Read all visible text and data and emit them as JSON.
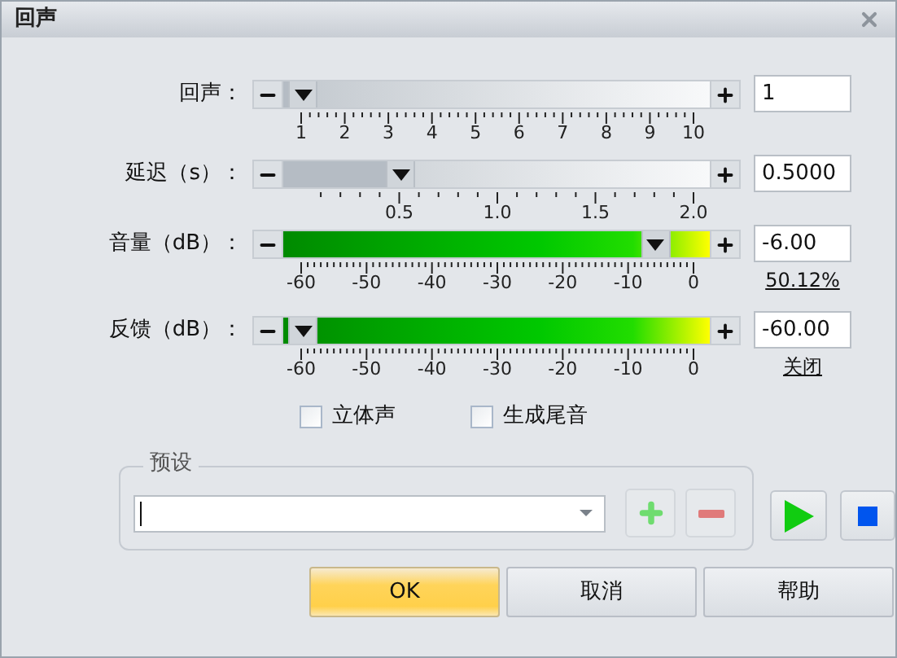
{
  "window": {
    "title": "回声"
  },
  "sliders": [
    {
      "label": "回声：",
      "kind": "plain",
      "level": 0,
      "value": "1",
      "ticks": [
        "1",
        "2",
        "3",
        "4",
        "5",
        "6",
        "7",
        "8",
        "9",
        "10"
      ]
    },
    {
      "label": "延迟（s）：",
      "kind": "plain",
      "level": 0.25,
      "value": "0.5000",
      "ticks": [
        "0.5",
        "1.0",
        "1.5",
        "2.0"
      ],
      "unlabeled_origin": true
    },
    {
      "label": "音量（dB）：",
      "kind": "gain",
      "level": 0.9,
      "value": "-6.00",
      "ticks": [
        "-60",
        "-50",
        "-40",
        "-30",
        "-20",
        "-10",
        "0"
      ],
      "note": "50.12%"
    },
    {
      "label": "反馈（dB）：",
      "kind": "gain",
      "level": 0,
      "value": "-60.00",
      "ticks": [
        "-60",
        "-50",
        "-40",
        "-30",
        "-20",
        "-10",
        "0"
      ],
      "note": "关闭"
    }
  ],
  "checkboxes": [
    {
      "label": "立体声",
      "checked": false
    },
    {
      "label": "生成尾音",
      "checked": false
    }
  ],
  "preset": {
    "legend": "预设"
  },
  "buttons": [
    {
      "label": "OK",
      "default": true
    },
    {
      "label": "取消",
      "default": false
    },
    {
      "label": "帮助",
      "default": false
    }
  ]
}
